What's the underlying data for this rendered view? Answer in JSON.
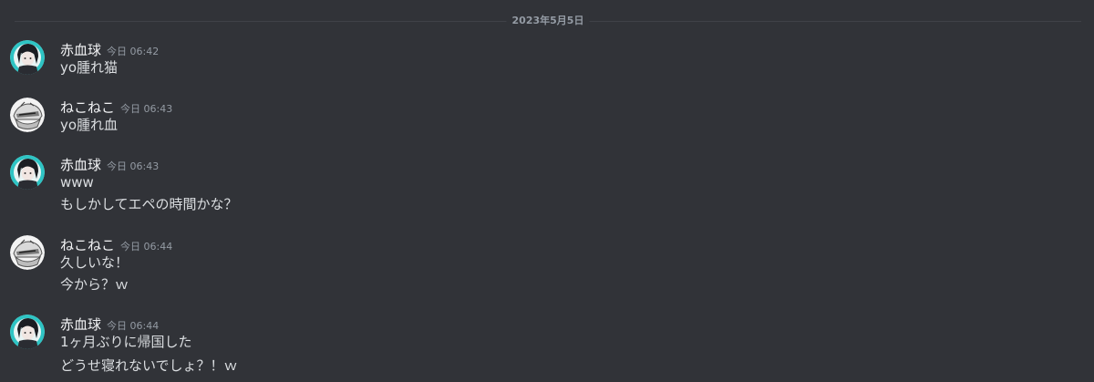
{
  "date_divider": "2023年5月5日",
  "messages": [
    {
      "user": "赤血球",
      "avatar_icon": "anime-character-avatar-teal",
      "time": "今日 06:42",
      "lines": [
        "yo腫れ猫"
      ]
    },
    {
      "user": "ねこねこ",
      "avatar_icon": "mecha-avatar-monochrome",
      "time": "今日 06:43",
      "lines": [
        "yo腫れ血"
      ]
    },
    {
      "user": "赤血球",
      "avatar_icon": "anime-character-avatar-teal",
      "time": "今日 06:43",
      "lines": [
        "www",
        "もしかしてエペの時間かな？"
      ]
    },
    {
      "user": "ねこねこ",
      "avatar_icon": "mecha-avatar-monochrome",
      "time": "今日 06:44",
      "lines": [
        "久しいな！",
        "今から？ｗ"
      ]
    },
    {
      "user": "赤血球",
      "avatar_icon": "anime-character-avatar-teal",
      "time": "今日 06:44",
      "lines": [
        "1ヶ月ぶりに帰国した",
        "どうせ寝れないでしょ？！ｗ"
      ]
    }
  ],
  "colors": {
    "background": "#313338",
    "text": "#dbdee1",
    "username": "#f2f3f5",
    "muted": "#949ba4",
    "avatar_teal": "#2ec4c4"
  }
}
